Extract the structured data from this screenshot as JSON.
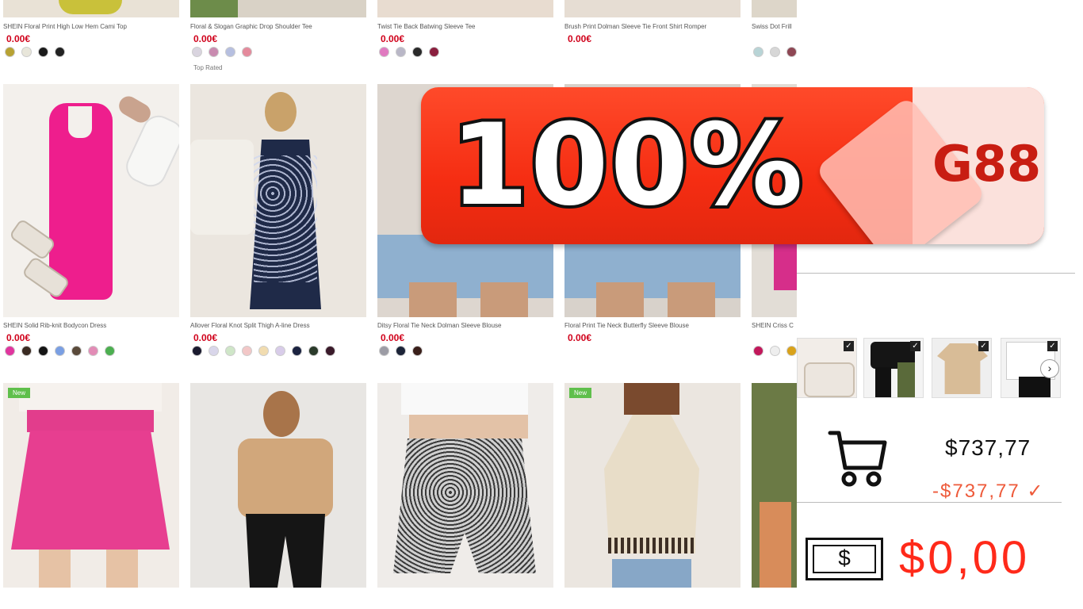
{
  "rows": [
    {
      "items": [
        {
          "name": "SHEIN Floral Print High Low Hem Cami Top",
          "price": "0.00€",
          "swatches": [
            "#b7a233",
            "#e8e6da",
            "#1a1a1a",
            "#222222"
          ]
        },
        {
          "name": "Floral & Slogan Graphic Drop Shoulder Tee",
          "price": "0.00€",
          "swatches": [
            "#d9d4df",
            "#c98bb0",
            "#b6bfe0",
            "#e48a9c"
          ],
          "tag": "Top Rated"
        },
        {
          "name": "Twist Tie Back Batwing Sleeve Tee",
          "price": "0.00€",
          "swatches": [
            "#e07ac0",
            "#b9b7c7",
            "#2a2a2a",
            "#8a1f3e"
          ]
        },
        {
          "name": "Brush Print Dolman Sleeve Tie Front Shirt Romper",
          "price": "0.00€",
          "swatches": []
        },
        {
          "name": "Swiss Dot Frill",
          "price": "",
          "swatches": [
            "#b8d4d6",
            "#d7d7d7",
            "#8e4754"
          ]
        }
      ]
    },
    {
      "items": [
        {
          "name": "SHEIN Solid Rib-knit Bodycon Dress",
          "price": "0.00€",
          "swatches": [
            "#e0359e",
            "#3a2a22",
            "#141414",
            "#7a9fe3",
            "#5a4a3a",
            "#e28cb6",
            "#4caf50"
          ]
        },
        {
          "name": "Allover Floral Knot Split Thigh A-line Dress",
          "price": "0.00€",
          "swatches": [
            "#1a1a2e",
            "#d9d6ea",
            "#cfe6c8",
            "#f2c7c7",
            "#f1dcb0",
            "#d8cce9",
            "#1b2340",
            "#2a3a2a",
            "#3a1a2a"
          ]
        },
        {
          "name": "Ditsy Floral Tie Neck Dolman Sleeve Blouse",
          "price": "0.00€",
          "swatches": [
            "#9c9ca5",
            "#1c2438",
            "#3a1f1a"
          ]
        },
        {
          "name": "Floral Print Tie Neck Butterfly Sleeve Blouse",
          "price": "0.00€",
          "swatches": []
        },
        {
          "name": "SHEIN Criss C",
          "price": "",
          "swatches": [
            "#c2185b",
            "#eeeeee",
            "#d9a21a"
          ]
        }
      ]
    },
    {
      "items": [
        {
          "badge": "New"
        },
        {},
        {},
        {
          "badge": "New"
        },
        {}
      ]
    }
  ],
  "promo": {
    "percent": "100%",
    "code": "G88"
  },
  "cart": {
    "total": "$737,77",
    "discount": "-$737,77 ✓",
    "final": "$0,00",
    "bill_symbol": "$",
    "next_label": "›",
    "check_label": "✓"
  },
  "icons": [
    "cart-icon",
    "dollar-bill-icon",
    "chevron-right-icon",
    "checkbox-icon"
  ],
  "colors": {
    "price": "#d0021b",
    "promo_red": "#f52d12",
    "final_price": "#ff2a1a",
    "discount": "#ee5a3a",
    "new_badge": "#5fbf4b"
  }
}
